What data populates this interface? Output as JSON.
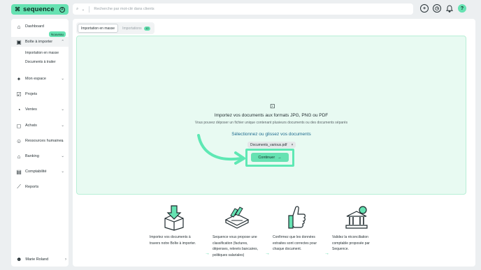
{
  "brand": {
    "mark": "⌘",
    "name": "sequence",
    "badge": "A"
  },
  "search": {
    "filter_glyph": "⌕",
    "placeholder": "Recherche par mot-clé dans clients"
  },
  "top_icons": [
    "plus-circle-icon",
    "clock-icon",
    "bell-icon",
    "help-icon"
  ],
  "top_icon_glyphs": {
    "plus": "+",
    "clock": "◷",
    "bell": "♫",
    "help": "?"
  },
  "sidebar": {
    "new_badge": "Nouveau",
    "items": [
      {
        "label": "Dashboard",
        "icon": "⌂"
      },
      {
        "label": "Boîte à importer",
        "icon": "▣",
        "chevron": "⌃"
      },
      {
        "label": "Mon espace",
        "icon": "✦",
        "chevron": "⌄"
      },
      {
        "label": "Projets",
        "icon": "☑"
      },
      {
        "label": "Ventes",
        "icon": "◔",
        "chevron": "⌄"
      },
      {
        "label": "Achats",
        "icon": "◻",
        "chevron": "⌄"
      },
      {
        "label": "Ressources humaines",
        "icon": "☺",
        "chevron": "⌄"
      },
      {
        "label": "Banking",
        "icon": "⌂",
        "chevron": "⌄"
      },
      {
        "label": "Comptabilité",
        "icon": "▤",
        "chevron": "⌄"
      },
      {
        "label": "Reports",
        "icon": "⟋"
      }
    ],
    "subitems": [
      "Importation en masse",
      "Documents à traiter"
    ],
    "user": {
      "name": "Marie Roland",
      "icon": "☻",
      "chevron": "›"
    }
  },
  "tabs": [
    {
      "label": "Importation en masse"
    },
    {
      "label": "Importations",
      "count": "12"
    }
  ],
  "dropzone": {
    "icon": "⊡",
    "title": "Importez vos documents aux formats JPG, PNG ou PDF",
    "subtitle": "Vous pouvez déposer un fichier unique contenant plusieurs documents ou des documents séparés",
    "link": "Sélectionnez ou glissez vos documents",
    "file_name": "Documents_various.pdf",
    "remove_glyph": "×",
    "continue_label": "Continuer",
    "continue_arrow": "→"
  },
  "accent_color": "#66e2b2",
  "steps": [
    {
      "text": "Importez vos documents à travers notre Boîte à importer."
    },
    {
      "text": "Sequence vous propose une classification (factures, dépenses, relevés bancaires, politiques salariales)"
    },
    {
      "text": "Confirmez que les données extraites sont correctes pour chaque document."
    },
    {
      "text": "Validez la réconciliation comptable proposée par Sequence."
    }
  ],
  "step_arrow": "→"
}
